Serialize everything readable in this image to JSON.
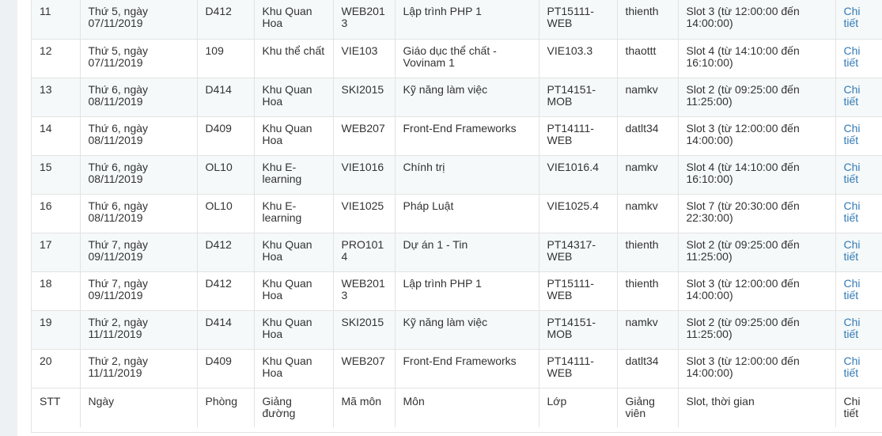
{
  "columns": [
    "STT",
    "Ngày",
    "Phòng",
    "Giảng đường",
    "Mã môn",
    "Môn",
    "Lớp",
    "Giảng viên",
    "Slot, thời gian",
    "Chi tiết"
  ],
  "rows": [
    {
      "stt": "11",
      "ngay": "Thứ 5, ngày 07/11/2019",
      "phong": "D412",
      "giang_duong": "Khu Quan Hoa",
      "ma_mon": "WEB2013",
      "mon": "Lập trình PHP 1",
      "lop": "PT15111-WEB",
      "giang_vien": "thienth",
      "slot": "Slot 3 (từ 12:00:00 đến 14:00:00)",
      "detail": "Chi tiết"
    },
    {
      "stt": "12",
      "ngay": "Thứ 5, ngày 07/11/2019",
      "phong": "109",
      "giang_duong": "Khu thể chất",
      "ma_mon": "VIE103",
      "mon": "Giáo dục thể chất - Vovinam 1",
      "lop": "VIE103.3",
      "giang_vien": "thaottt",
      "slot": "Slot 4 (từ 14:10:00 đến 16:10:00)",
      "detail": "Chi tiết"
    },
    {
      "stt": "13",
      "ngay": "Thứ 6, ngày 08/11/2019",
      "phong": "D414",
      "giang_duong": "Khu Quan Hoa",
      "ma_mon": "SKI2015",
      "mon": "Kỹ năng làm việc",
      "lop": "PT14151-MOB",
      "giang_vien": "namkv",
      "slot": "Slot 2 (từ 09:25:00 đến 11:25:00)",
      "detail": "Chi tiết"
    },
    {
      "stt": "14",
      "ngay": "Thứ 6, ngày 08/11/2019",
      "phong": "D409",
      "giang_duong": "Khu Quan Hoa",
      "ma_mon": "WEB207",
      "mon": "Front-End Frameworks",
      "lop": "PT14111-WEB",
      "giang_vien": "datlt34",
      "slot": "Slot 3 (từ 12:00:00 đến 14:00:00)",
      "detail": "Chi tiết"
    },
    {
      "stt": "15",
      "ngay": "Thứ 6, ngày 08/11/2019",
      "phong": "OL10",
      "giang_duong": "Khu E-learning",
      "ma_mon": "VIE1016",
      "mon": "Chính trị",
      "lop": "VIE1016.4",
      "giang_vien": "namkv",
      "slot": "Slot 4 (từ 14:10:00 đến 16:10:00)",
      "detail": "Chi tiết"
    },
    {
      "stt": "16",
      "ngay": "Thứ 6, ngày 08/11/2019",
      "phong": "OL10",
      "giang_duong": "Khu E-learning",
      "ma_mon": "VIE1025",
      "mon": "Pháp Luật",
      "lop": "VIE1025.4",
      "giang_vien": "namkv",
      "slot": "Slot 7 (từ 20:30:00 đến 22:30:00)",
      "detail": "Chi tiết"
    },
    {
      "stt": "17",
      "ngay": "Thứ 7, ngày 09/11/2019",
      "phong": "D412",
      "giang_duong": "Khu Quan Hoa",
      "ma_mon": "PRO1014",
      "mon": "Dự án 1 - Tin",
      "lop": "PT14317-WEB",
      "giang_vien": "thienth",
      "slot": "Slot 2 (từ 09:25:00 đến 11:25:00)",
      "detail": "Chi tiết"
    },
    {
      "stt": "18",
      "ngay": "Thứ 7, ngày 09/11/2019",
      "phong": "D412",
      "giang_duong": "Khu Quan Hoa",
      "ma_mon": "WEB2013",
      "mon": "Lập trình PHP 1",
      "lop": "PT15111-WEB",
      "giang_vien": "thienth",
      "slot": "Slot 3 (từ 12:00:00 đến 14:00:00)",
      "detail": "Chi tiết"
    },
    {
      "stt": "19",
      "ngay": "Thứ 2, ngày 11/11/2019",
      "phong": "D414",
      "giang_duong": "Khu Quan Hoa",
      "ma_mon": "SKI2015",
      "mon": "Kỹ năng làm việc",
      "lop": "PT14151-MOB",
      "giang_vien": "namkv",
      "slot": "Slot 2 (từ 09:25:00 đến 11:25:00)",
      "detail": "Chi tiết"
    },
    {
      "stt": "20",
      "ngay": "Thứ 2, ngày 11/11/2019",
      "phong": "D409",
      "giang_duong": "Khu Quan Hoa",
      "ma_mon": "WEB207",
      "mon": "Front-End Frameworks",
      "lop": "PT14111-WEB",
      "giang_vien": "datlt34",
      "slot": "Slot 3 (từ 12:00:00 đến 14:00:00)",
      "detail": "Chi tiết"
    }
  ],
  "colors": {
    "link": "#337ab7",
    "stripe": "#f5f9f9",
    "border": "#e3e3e3",
    "text": "#333333"
  }
}
